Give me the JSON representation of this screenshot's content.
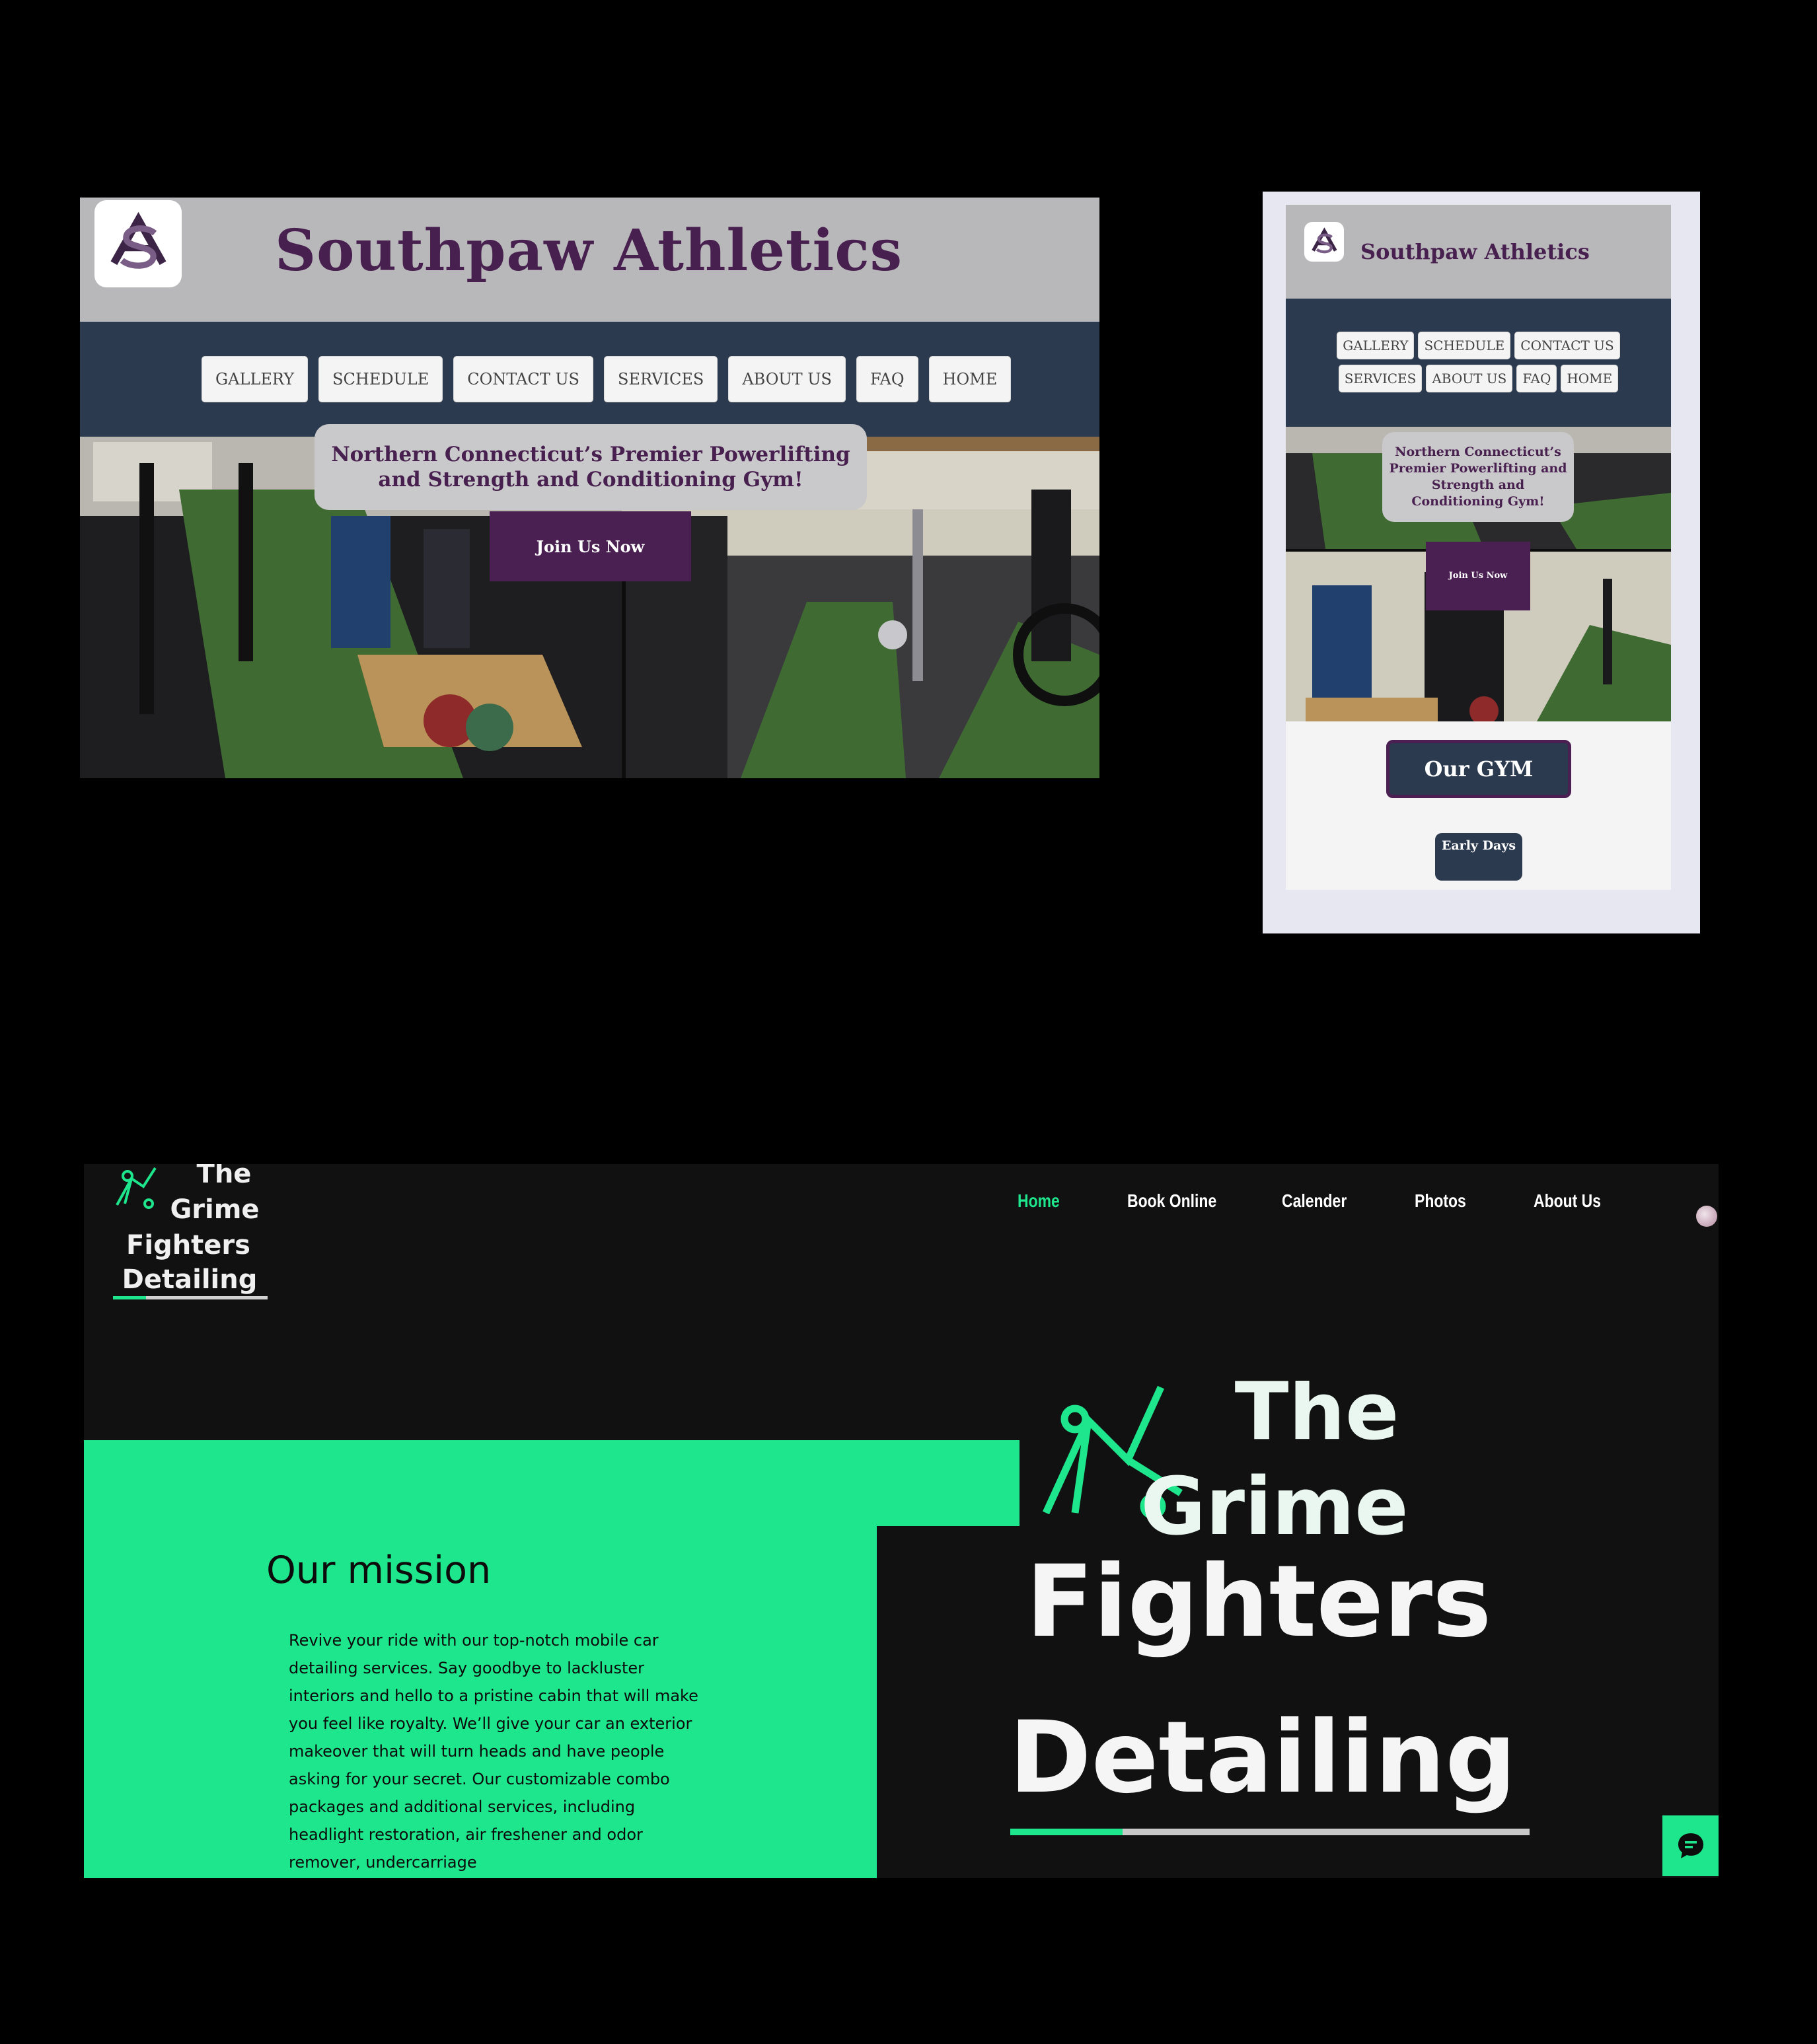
{
  "southpaw_desktop": {
    "title": "Southpaw Athletics",
    "logo_icon": "sa-monogram-icon",
    "nav": [
      "GALLERY",
      "SCHEDULE",
      "CONTACT US",
      "SERVICES",
      "ABOUT US",
      "FAQ",
      "HOME"
    ],
    "tagline": "Northern Connecticut’s Premier Powerlifting and Strength and Conditioning Gym!",
    "cta": "Join Us Now",
    "colors": {
      "header_bg": "#b8b8ba",
      "nav_bg": "#2c3a50",
      "brand_purple": "#4a1f52"
    }
  },
  "southpaw_mobile": {
    "title": "Southpaw Athletics",
    "nav_row1": [
      "GALLERY",
      "SCHEDULE",
      "CONTACT US"
    ],
    "nav_row2": [
      "SERVICES",
      "ABOUT US",
      "FAQ",
      "HOME"
    ],
    "tagline": "Northern Connecticut’s Premier Powerlifting and Strength and Conditioning Gym!",
    "cta": "Join Us Now",
    "our_gym": "Our GYM",
    "early_days": "Early Days"
  },
  "grime": {
    "logo_lines": [
      "The",
      "Grime",
      "Fighters",
      "Detailing"
    ],
    "nav": [
      {
        "label": "Home",
        "active": true
      },
      {
        "label": "Book Online",
        "active": false
      },
      {
        "label": "Calender",
        "active": false
      },
      {
        "label": "Photos",
        "active": false
      },
      {
        "label": "About Us",
        "active": false
      }
    ],
    "mission_title": "Our mission",
    "mission_text": "Revive your ride with our top-notch mobile car detailing services. Say goodbye to lackluster interiors and hello to a pristine cabin that will make you feel like royalty. We’ll give your car an exterior makeover that will turn heads and have people asking for your secret. Our customizable combo packages and additional services, including headlight restoration, air freshener and odor remover, undercarriage",
    "chat_icon": "chat-bubble-icon",
    "colors": {
      "accent": "#1ee68c",
      "bg": "#111111"
    }
  }
}
